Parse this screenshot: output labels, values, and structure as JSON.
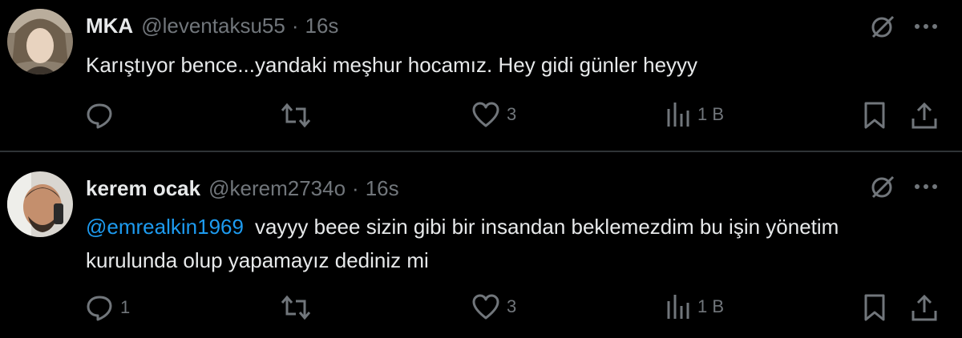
{
  "tweets": [
    {
      "name": "MKA",
      "handle": "@leventaksu55",
      "separator": "·",
      "time": "16s",
      "mention": "",
      "text": "Karıştıyor bence...yandaki meşhur hocamız.  Hey gidi günler heyyy",
      "replies": "",
      "retweets": "",
      "likes": "3",
      "views": "1 B"
    },
    {
      "name": "kerem ocak",
      "handle": "@kerem2734o",
      "separator": "·",
      "time": "16s",
      "mention": "@emrealkin1969",
      "text": "vayyy beee sizin gibi bir insandan beklemezdim bu işin yönetim kurulunda olup yapamayız dediniz mi",
      "replies": "1",
      "retweets": "",
      "likes": "3",
      "views": "1 B"
    }
  ],
  "colors": {
    "background": "#000000",
    "text": "#e7e9ea",
    "muted": "#71767b",
    "link": "#1d9bf0",
    "divider": "#2f3336"
  },
  "icons": [
    "grok-icon",
    "more-icon",
    "reply-icon",
    "retweet-icon",
    "like-icon",
    "views-icon",
    "bookmark-icon",
    "share-icon"
  ]
}
